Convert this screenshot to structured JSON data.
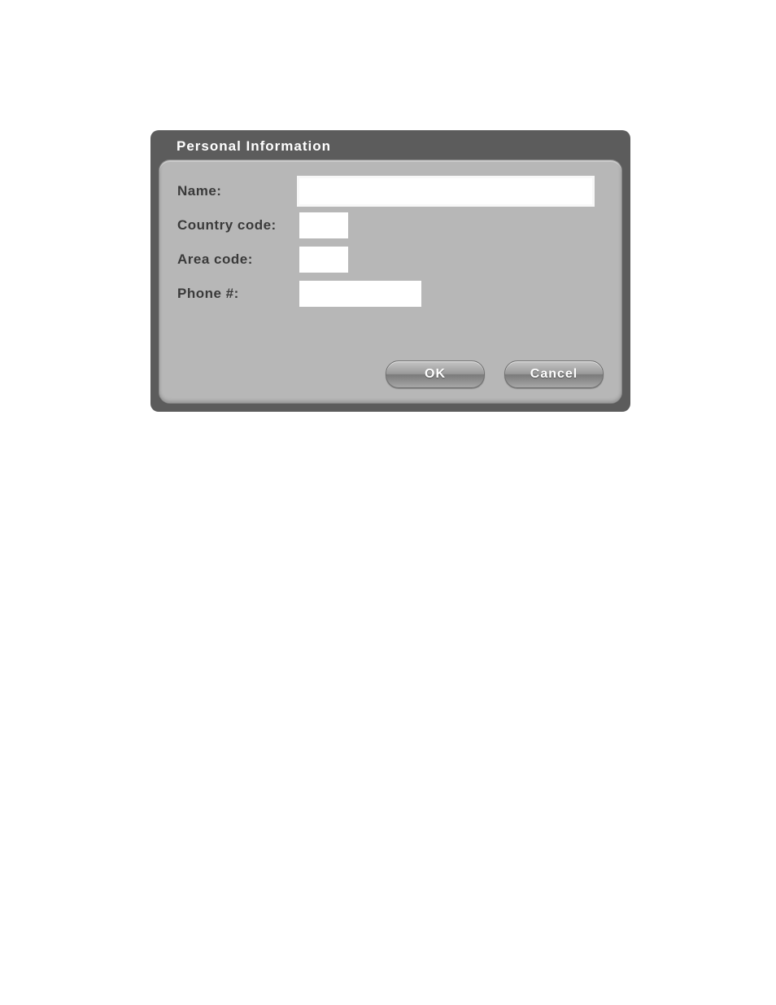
{
  "dialog": {
    "title": "Personal Information",
    "fields": {
      "name": {
        "label": "Name:",
        "value": ""
      },
      "countryCode": {
        "label": "Country code:",
        "value": ""
      },
      "areaCode": {
        "label": "Area code:",
        "value": ""
      },
      "phone": {
        "label": "Phone #:",
        "value": ""
      }
    },
    "buttons": {
      "ok": "OK",
      "cancel": "Cancel"
    }
  }
}
